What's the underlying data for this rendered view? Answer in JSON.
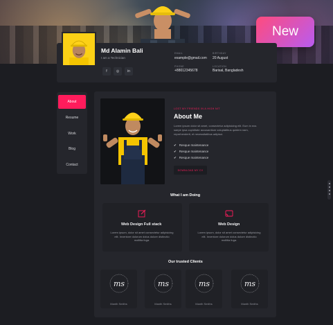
{
  "badge": {
    "label": "New"
  },
  "profile": {
    "name": "Md Alamin Bali",
    "role": "I am a Technician",
    "email_label": "EMAIL",
    "email": "example@gmail.com",
    "birthday_label": "BIRTHDAY",
    "birthday": "20 August",
    "phone_label": "PHONE",
    "phone": "+88012345678",
    "location_label": "LOCATION",
    "location": "Barisal, Bangladesh",
    "socials": [
      "facebook-icon",
      "instagram-icon",
      "linkedin-icon"
    ]
  },
  "menu": {
    "items": [
      "About",
      "Resume",
      "Work",
      "Blog",
      "Contact"
    ],
    "active": "About"
  },
  "about": {
    "kicker": "LOST MY FRIENDS IN A HIGH NIT",
    "title": "About Me",
    "text": "Lorem ipsum dolor sit amet, consectetur adipisicing elit. Eum in eos saepe ipsa cupiditate accusantium voluptatibus quidem nam, reprehenderit, et necessitatibus adipisci.",
    "checks": [
      "Resque maintenance",
      "Resque maintenance",
      "Resque maintenance"
    ],
    "download_label": "DOWNLOAD MY CV"
  },
  "services": {
    "title": "What I am Doing",
    "items": [
      {
        "title": "Web Design Full stack",
        "text": "Lorem ipsum, dolor sit amet consectetur adipisicing elit. Inventore dolorum dolus dolore distinctio mollitia fuga.",
        "icon": "edit-icon"
      },
      {
        "title": "Web Design",
        "text": "Lorem ipsum, dolor sit amet consectetur adipisicing elit. Inventore dolorum dolus dolore distinctio mollitia fuga.",
        "icon": "cast-icon"
      }
    ]
  },
  "clients": {
    "title": "Our trusted Clients",
    "items": [
      {
        "name": "Manth Smiths",
        "logo_text": "ms"
      },
      {
        "name": "Manth Smiths",
        "logo_text": "ms"
      },
      {
        "name": "Manth Smiths",
        "logo_text": "ms"
      },
      {
        "name": "Manth Smiths",
        "logo_text": "ms"
      }
    ]
  },
  "colors": {
    "accent": "#ff1c5c",
    "background": "#1c1d22",
    "card": "#25262c",
    "badge_from": "#ff4b7d",
    "badge_to": "#b85cf0"
  }
}
